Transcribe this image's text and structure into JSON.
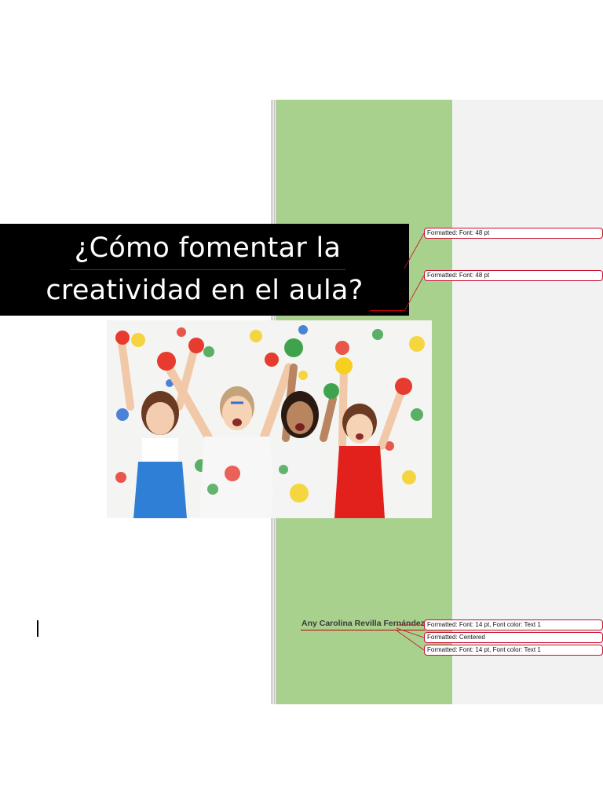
{
  "document": {
    "title_line1": "¿Cómo fomentar la",
    "title_line2": "creatividad en el aula?",
    "author": "Any Carolina Revilla Fernández",
    "photo_alt": "children-painted-hands-photo"
  },
  "comments": [
    {
      "prefix": "Formatted:",
      "text": "Font: 48 pt"
    },
    {
      "prefix": "Formatted:",
      "text": "Font: 48 pt"
    },
    {
      "prefix": "Formatted:",
      "text": "Font: 14 pt, Font color: Text 1"
    },
    {
      "prefix": "Formatted:",
      "text": "Centered"
    },
    {
      "prefix": "Formatted:",
      "text": "Font: 14 pt, Font color: Text 1"
    }
  ],
  "colors": {
    "sidebar_green": "#a9d18e",
    "banner_black": "#000000",
    "markup_pane": "#f2f2f2",
    "revision_red": "#c8102e"
  }
}
